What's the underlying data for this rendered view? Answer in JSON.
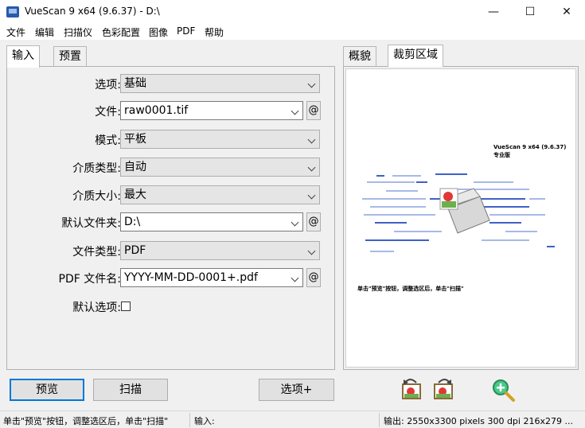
{
  "window": {
    "title": "VueScan 9 x64 (9.6.37) - D:\\",
    "minimize": "—",
    "maximize": "☐",
    "close": "✕"
  },
  "menu": [
    "文件",
    "编辑",
    "扫描仪",
    "色彩配置",
    "图像",
    "PDF",
    "帮助"
  ],
  "left_tabs": {
    "input": "输入",
    "prefs": "预置"
  },
  "right_tabs": {
    "overview": "概貌",
    "crop": "裁剪区域"
  },
  "form": {
    "options_label": "选项:",
    "options_value": "基础",
    "file_label": "文件:",
    "file_value": "raw0001.tif",
    "mode_label": "模式:",
    "mode_value": "平板",
    "media_type_label": "介质类型:",
    "media_type_value": "自动",
    "media_size_label": "介质大小:",
    "media_size_value": "最大",
    "default_folder_label": "默认文件夹:",
    "default_folder_value": "D:\\",
    "file_type_label": "文件类型:",
    "file_type_value": "PDF",
    "pdf_name_label": "PDF 文件名:",
    "pdf_name_value": "YYYY-MM-DD-0001+.pdf",
    "default_options_label": "默认选项:",
    "at_label": "@"
  },
  "preview": {
    "brand": "VueScan 9 x64 (9.6.37)",
    "edition": "专业版",
    "hint": "单击\"预览\"按钮，调整选区后，单击\"扫描\""
  },
  "buttons": {
    "preview": "预览",
    "scan": "扫描",
    "more_options": "选项+"
  },
  "status": {
    "hint": "单击\"预览\"按钮，调整选区后，单击\"扫描\"",
    "input": "输入:",
    "output": "输出: 2550x3300 pixels 300 dpi 216x279 ..."
  },
  "colors": {
    "accent": "#0078d7",
    "scan_line": "#3f60c8",
    "scan_line_light": "#a8b8e8"
  }
}
